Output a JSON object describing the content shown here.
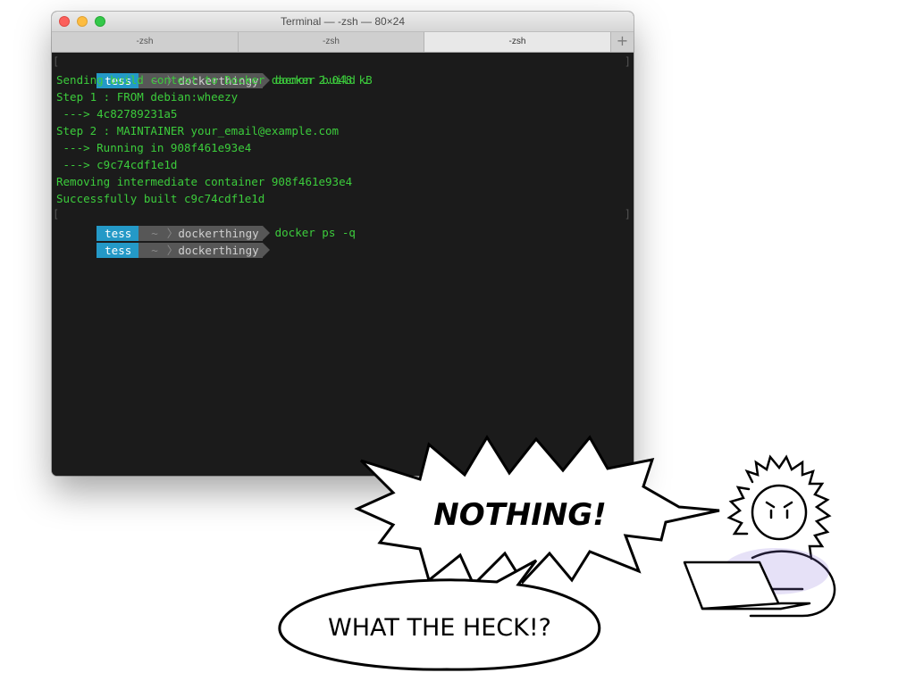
{
  "window": {
    "title": "Terminal — -zsh — 80×24",
    "tabs": [
      "-zsh",
      "-zsh",
      "-zsh"
    ],
    "add_tab": "+"
  },
  "terminal": {
    "prompt1": {
      "user": "tess",
      "home": "~",
      "dir": "dockerthingy",
      "cmd": "docker build ."
    },
    "output": [
      "Sending build context to Docker daemon 2.048 kB",
      "Step 1 : FROM debian:wheezy",
      " ---> 4c82789231a5",
      "Step 2 : MAINTAINER your_email@example.com",
      " ---> Running in 908f461e93e4",
      " ---> c9c74cdf1e1d",
      "Removing intermediate container 908f461e93e4",
      "Successfully built c9c74cdf1e1d"
    ],
    "prompt2": {
      "user": "tess",
      "home": "~",
      "dir": "dockerthingy",
      "cmd": "docker ps -q"
    },
    "prompt3": {
      "user": "tess",
      "home": "~",
      "dir": "dockerthingy"
    },
    "bracket_left": "[",
    "bracket_right": "]"
  },
  "comic": {
    "shout": "NOTHING!",
    "speech": "WHAT THE HECK!?"
  },
  "colors": {
    "terminal_bg": "#1b1b1b",
    "output_green": "#3ccc3c",
    "prompt_user": "#2499c7",
    "prompt_dir": "#575757"
  }
}
